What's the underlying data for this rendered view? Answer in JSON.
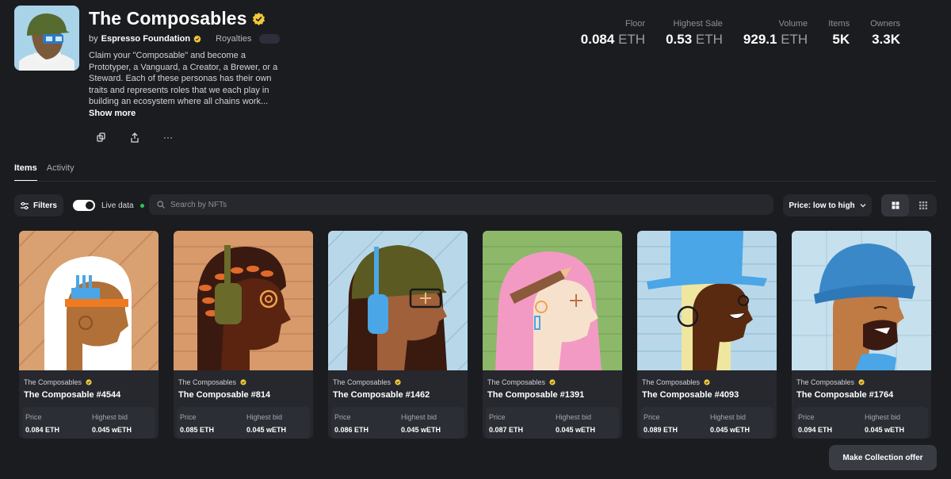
{
  "collection": {
    "title": "The Composables",
    "by_prefix": "by",
    "creator": "Espresso Foundation",
    "royalties_label": "Royalties",
    "description": "Claim your \"Composable\" and become a Prototyper, a Vanguard, a Creator, a Brewer, or a Steward. Each of these personas has their own traits and represents roles that we each play in building an ecosystem where all chains work...",
    "show_more": "Show more"
  },
  "actions": [
    {
      "icon": "copy-icon"
    },
    {
      "icon": "share-icon"
    },
    {
      "icon": "more-icon",
      "glyph": "···"
    }
  ],
  "stats": [
    {
      "label": "Floor",
      "value": "0.084",
      "unit": "ETH"
    },
    {
      "label": "Highest Sale",
      "value": "0.53",
      "unit": "ETH"
    },
    {
      "label": "Volume",
      "value": "929.1",
      "unit": "ETH"
    },
    {
      "label": "Items",
      "value": "5K",
      "unit": ""
    },
    {
      "label": "Owners",
      "value": "3.3K",
      "unit": ""
    }
  ],
  "tabs": [
    {
      "label": "Items",
      "active": true
    },
    {
      "label": "Activity",
      "active": false
    }
  ],
  "toolbar": {
    "filters_label": "Filters",
    "live_label": "Live data",
    "live_on": true,
    "search_placeholder": "Search by NFTs",
    "sort_label": "Price: low to high"
  },
  "items": [
    {
      "collection": "The Composables",
      "name": "The Composable #4544",
      "price_label": "Price",
      "price": "0.084 ETH",
      "bid_label": "Highest bid",
      "bid": "0.045 wETH"
    },
    {
      "collection": "The Composables",
      "name": "The Composable #814",
      "price_label": "Price",
      "price": "0.085 ETH",
      "bid_label": "Highest bid",
      "bid": "0.045 wETH"
    },
    {
      "collection": "The Composables",
      "name": "The Composable #1462",
      "price_label": "Price",
      "price": "0.086 ETH",
      "bid_label": "Highest bid",
      "bid": "0.045 wETH"
    },
    {
      "collection": "The Composables",
      "name": "The Composable #1391",
      "price_label": "Price",
      "price": "0.087 ETH",
      "bid_label": "Highest bid",
      "bid": "0.045 wETH"
    },
    {
      "collection": "The Composables",
      "name": "The Composable #4093",
      "price_label": "Price",
      "price": "0.089 ETH",
      "bid_label": "Highest bid",
      "bid": "0.045 wETH"
    },
    {
      "collection": "The Composables",
      "name": "The Composable #1764",
      "price_label": "Price",
      "price": "0.094 ETH",
      "bid_label": "Highest bid",
      "bid": "0.045 wETH"
    }
  ],
  "offer_button": "Make Collection offer",
  "colors": {
    "background": "#1b1c20",
    "panel": "#26282e",
    "verified": "#f3c93a",
    "live_dot": "#32c35b"
  }
}
